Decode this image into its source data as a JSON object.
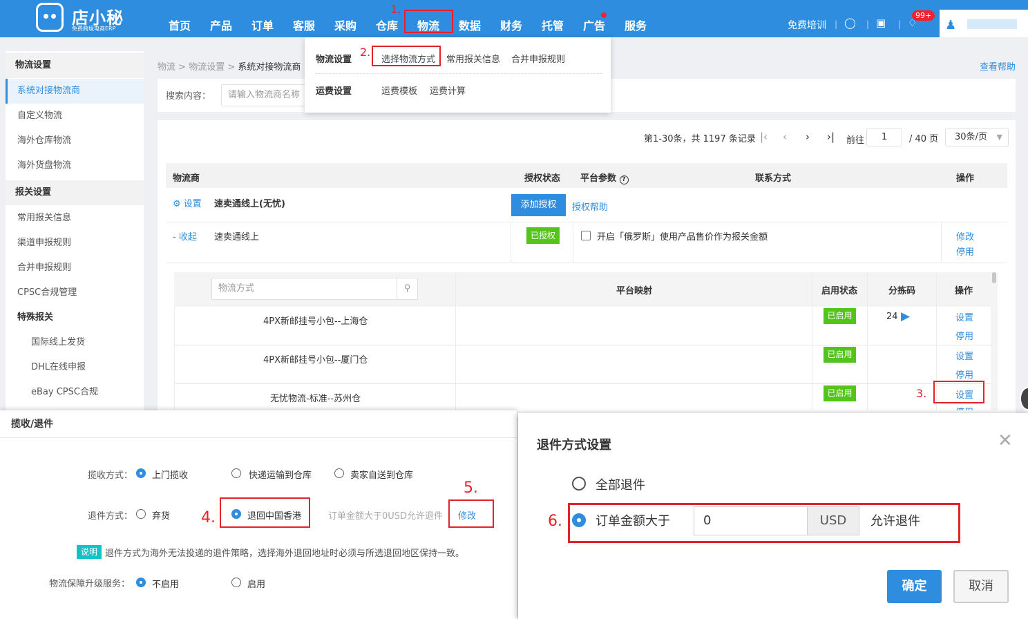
{
  "header": {
    "logo_text": "店小秘",
    "logo_sub": "免费跨境电商ERP",
    "nav": [
      "首页",
      "产品",
      "订单",
      "客服",
      "采购",
      "仓库",
      "物流",
      "数据",
      "财务",
      "托管",
      "广告",
      "服务"
    ],
    "training": "免费培训",
    "badge": "99+",
    "icons": [
      "headset-icon",
      "book-icon",
      "bell-icon",
      "user-icon"
    ]
  },
  "dropdown": {
    "section1": "物流设置",
    "items1": [
      "选择物流方式",
      "常用报关信息",
      "合并申报规则"
    ],
    "section2": "运费设置",
    "items2": [
      "运费模板",
      "运费计算"
    ]
  },
  "sidebar": {
    "h1": "物流设置",
    "items1": [
      "系统对接物流商",
      "自定义物流",
      "海外仓库物流",
      "海外货盘物流"
    ],
    "h2": "报关设置",
    "items2": [
      "常用报关信息",
      "渠道申报规则",
      "合并申报规则",
      "CPSC合规管理"
    ],
    "h3": "特殊报关",
    "items3": [
      "国际线上发货",
      "DHL在线申报",
      "eBay CPSC合规"
    ]
  },
  "main": {
    "breadcrumb": [
      "物流",
      "物流设置",
      "系统对接物流商"
    ],
    "help": "查看帮助",
    "search_label": "搜索内容：",
    "search_placeholder": "请输入物流商名称",
    "pagination": {
      "summary": "第1-30条，共 1197 条记录",
      "goto": "前往",
      "page": "1",
      "total": "/ 40 页",
      "size": "30条/页"
    },
    "table_headers": [
      "物流商",
      "授权状态",
      "平台参数",
      "联系方式",
      "操作"
    ],
    "row1": {
      "settings": "设置",
      "name": "速卖通线上(无忧)",
      "add_auth": "添加授权",
      "auth_help": "授权帮助"
    },
    "row2": {
      "collapse": "- 收起",
      "name": "速卖通线上",
      "status": "已授权",
      "checkbox_label": "开启「俄罗斯」使用产品售价作为报关金额",
      "edit": "修改",
      "disable": "停用"
    },
    "inner": {
      "search_placeholder": "物流方式",
      "headers": [
        "平台映射",
        "启用状态",
        "分拣码",
        "操作"
      ],
      "rows": [
        {
          "name": "4PX新邮挂号小包--上海仓",
          "status": "已启用",
          "code": "24",
          "set": "设置",
          "disable": "停用"
        },
        {
          "name": "4PX新邮挂号小包--厦门仓",
          "status": "已启用",
          "code": "",
          "set": "设置",
          "disable": "停用"
        },
        {
          "name": "无忧物流-标准--苏州仓",
          "status": "已启用",
          "code": "",
          "set": "设置",
          "disable": "停用"
        }
      ]
    }
  },
  "panel": {
    "title": "揽收/退件",
    "pickup_label": "揽收方式：",
    "pickup_options": [
      "上门揽收",
      "快递运输到仓库",
      "卖家自送到仓库"
    ],
    "return_label": "退件方式：",
    "return_options": [
      "弃货",
      "退回中国香港"
    ],
    "return_hint": "订单金额大于0USD允许退件",
    "modify": "修改",
    "tip_tag": "说明",
    "tip_text": "退件方式为海外无法投递的退件策略，选择海外退回地址时必须与所选退回地区保持一致。",
    "insurance_label": "物流保障升级服务：",
    "insurance_options": [
      "不启用",
      "启用"
    ]
  },
  "modal": {
    "title": "退件方式设置",
    "option_all": "全部退件",
    "option_amount": "订单金额大于",
    "amount_value": "0",
    "currency": "USD",
    "suffix": "允许退件",
    "confirm": "确定",
    "cancel": "取消"
  },
  "annotations": [
    "1.",
    "2.",
    "3.",
    "4.",
    "5.",
    "6."
  ],
  "colors": {
    "primary": "#2e8ddf",
    "success": "#52c41a",
    "annotation": "#e6212a",
    "tip": "#13c2c2"
  }
}
